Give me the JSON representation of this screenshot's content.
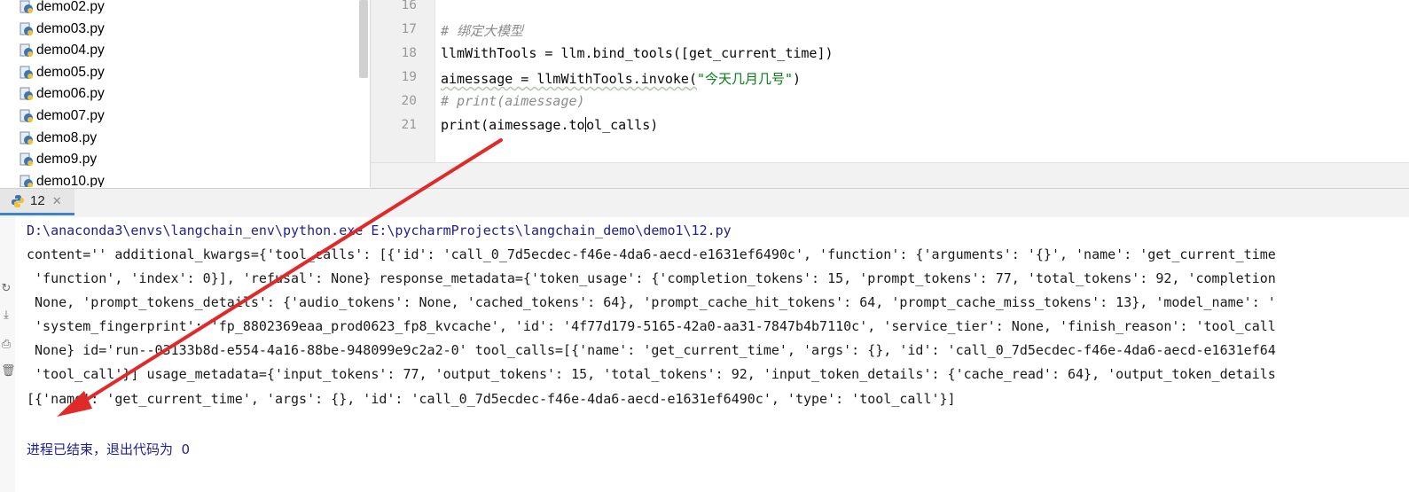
{
  "tree": {
    "files": [
      "demo02.py",
      "demo03.py",
      "demo04.py",
      "demo05.py",
      "demo06.py",
      "demo07.py",
      "demo8.py",
      "demo9.py",
      "demo10.py"
    ]
  },
  "editor": {
    "lines": [
      {
        "num": "16",
        "text": ""
      },
      {
        "num": "17",
        "text": "# 绑定大模型"
      },
      {
        "num": "18",
        "text": "llmWithTools = llm.bind_tools([get_current_time])"
      },
      {
        "num": "19",
        "pre": "aimessage = llmWithTools.invoke(",
        "str": "\"今天几月几号\"",
        "post": ")"
      },
      {
        "num": "20",
        "text": "# print(aimessage)"
      },
      {
        "num": "21",
        "pre": "print(aimessage.to",
        "post": "ol_calls)"
      }
    ]
  },
  "run": {
    "tab_label": "12",
    "command": "D:\\anaconda3\\envs\\langchain_env\\python.exe E:\\pycharmProjects\\langchain_demo\\demo1\\12.py",
    "output": [
      "content='' additional_kwargs={'tool_calls': [{'id': 'call_0_7d5ecdec-f46e-4da6-aecd-e1631ef6490c', 'function': {'arguments': '{}', 'name': 'get_current_time",
      " 'function', 'index': 0}], 'refusal': None} response_metadata={'token_usage': {'completion_tokens': 15, 'prompt_tokens': 77, 'total_tokens': 92, 'completion",
      " None, 'prompt_tokens_details': {'audio_tokens': None, 'cached_tokens': 64}, 'prompt_cache_hit_tokens': 64, 'prompt_cache_miss_tokens': 13}, 'model_name': '",
      " 'system_fingerprint': 'fp_8802369eaa_prod0623_fp8_kvcache', 'id': '4f77d179-5165-42a0-aa31-7847b4b7110c', 'service_tier': None, 'finish_reason': 'tool_call",
      " None} id='run--03133b8d-e554-4a16-88be-948099e9c2a2-0' tool_calls=[{'name': 'get_current_time', 'args': {}, 'id': 'call_0_7d5ecdec-f46e-4da6-aecd-e1631ef64",
      " 'tool_call'}] usage_metadata={'input_tokens': 77, 'output_tokens': 15, 'total_tokens': 92, 'input_token_details': {'cache_read': 64}, 'output_token_details",
      "[{'name': 'get_current_time', 'args': {}, 'id': 'call_0_7d5ecdec-f46e-4da6-aecd-e1631ef6490c', 'type': 'tool_call'}]"
    ],
    "exit_message": "进程已结束，退出代码为  0"
  },
  "colors": {
    "arrow": "#e02a2a",
    "tab_underline": "#4083c9",
    "comment": "#8c8c8c",
    "string": "#067d17"
  },
  "icons": {
    "file": "python-file-icon",
    "tab": "python-run-icon"
  }
}
